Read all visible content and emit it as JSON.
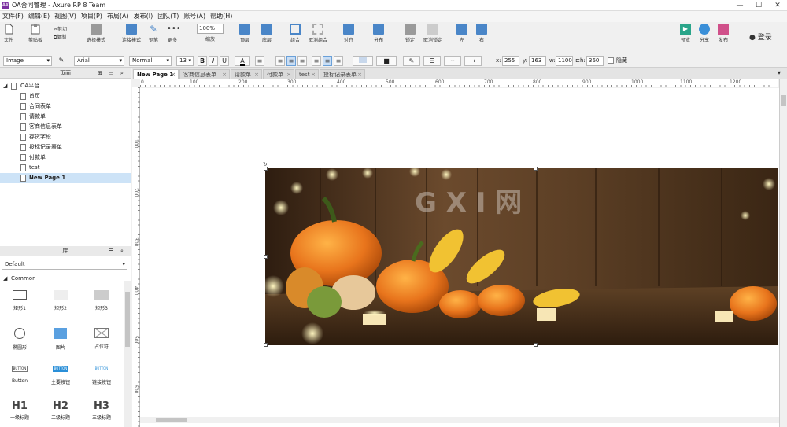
{
  "window": {
    "title": "OA合同管理 - Axure RP 8 Team",
    "app_icon": "AX",
    "controls": [
      "—",
      "☐",
      "✕"
    ]
  },
  "menu": [
    "文件(F)",
    "编辑(E)",
    "视图(V)",
    "项目(P)",
    "布局(A)",
    "发布(I)",
    "团队(T)",
    "账号(A)",
    "帮助(H)"
  ],
  "toolbar": {
    "file": "文件",
    "paste": "剪贴板",
    "cut": "剪切",
    "copy": "复制",
    "select_mode": "选择模式",
    "connect": "连接模式",
    "pen": "钢笔",
    "more": "更多",
    "zoom_value": "100%",
    "zoom_label": "缩放",
    "top": "顶层",
    "bottom": "底层",
    "group": "组合",
    "ungroup": "取消组合",
    "align": "对齐",
    "distribute": "分布",
    "lock": "锁定",
    "unlock": "取消锁定",
    "left": "左",
    "right": "右",
    "preview": "预览",
    "share": "分享",
    "publish": "发布",
    "login": "登录"
  },
  "format": {
    "widget_type": "Image",
    "font": "Arial",
    "weight": "Normal",
    "size": "13",
    "bold": "B",
    "italic": "I",
    "underline": "U",
    "x_label": "x:",
    "x": "255",
    "y_label": "y:",
    "y": "163",
    "w_label": "w:",
    "w": "1100",
    "h_label": "h:",
    "h": "360",
    "hidden": "隐藏"
  },
  "pages_panel": {
    "title": "页面",
    "root": "OA平台",
    "pages": [
      "首页",
      "合同表单",
      "请款单",
      "客商信息表单",
      "存货字段",
      "投标记录表单",
      "付款单",
      "test",
      "New Page 1"
    ],
    "selected_index": 8
  },
  "library_panel": {
    "title": "库",
    "library": "Default",
    "section": "Common",
    "items": [
      {
        "label": "矩形1"
      },
      {
        "label": "矩形2"
      },
      {
        "label": "矩形3"
      },
      {
        "label": "椭圆形"
      },
      {
        "label": "图片"
      },
      {
        "label": "占位符"
      },
      {
        "label": "Button",
        "preview": "BUTTON"
      },
      {
        "label": "主要按钮",
        "preview": "BUTTON"
      },
      {
        "label": "链接按钮",
        "preview": "BUTTON"
      },
      {
        "label": "一级标题",
        "preview": "H1"
      },
      {
        "label": "二级标题",
        "preview": "H2"
      },
      {
        "label": "三级标题",
        "preview": "H3"
      }
    ]
  },
  "tabs": [
    "New Page 1",
    "客商信息表单",
    "请款单",
    "付款单",
    "test",
    "投标记录表单"
  ],
  "ruler": {
    "h": [
      "0",
      "100",
      "200",
      "300",
      "400",
      "500",
      "600",
      "700",
      "800",
      "900",
      "1000",
      "1100",
      "1200"
    ],
    "v": [
      "100",
      "200",
      "300",
      "400",
      "500",
      "600"
    ]
  },
  "canvas_image": {
    "description_icon": "autumn-pumpkins-photo",
    "watermark": "G X I 网"
  }
}
